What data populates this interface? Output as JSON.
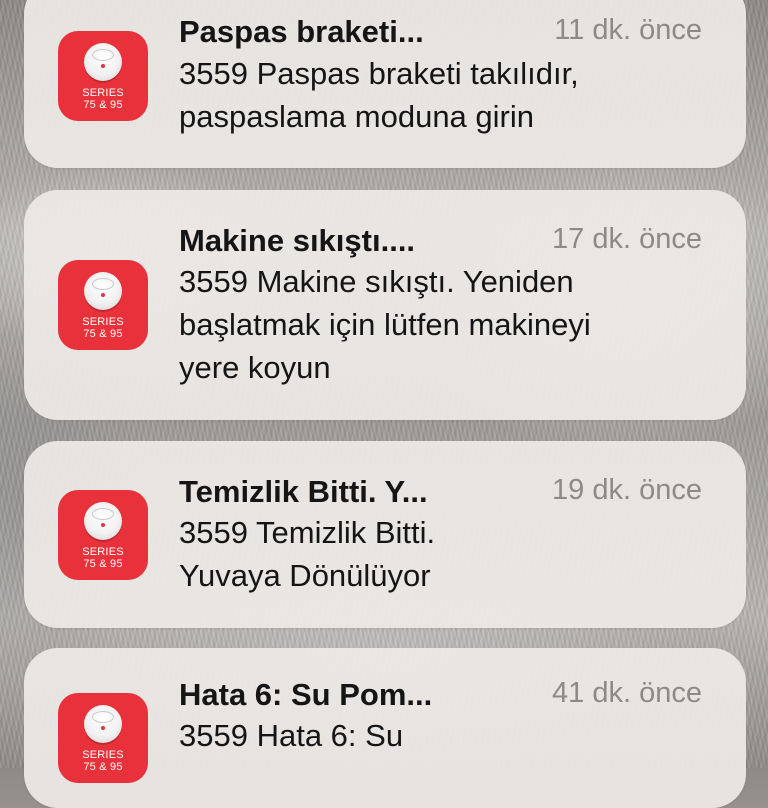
{
  "app": {
    "icon_name": "robot-vacuum-app-icon",
    "icon_color": "#e8313a",
    "icon_text_line1": "SERIES",
    "icon_text_line2": "75 & 95"
  },
  "notifications": [
    {
      "title": "Paspas braketi...",
      "time": "11 dk. önce",
      "body_line1": "3559  Paspas braketi takılıdır,",
      "body_line2": "paspaslama moduna girin",
      "body_line3": ""
    },
    {
      "title": "Makine sıkıştı....",
      "time": "17 dk. önce",
      "body_line1": "3559 Makine sıkıştı. Yeniden",
      "body_line2": "başlatmak için lütfen makineyi",
      "body_line3": "yere koyun"
    },
    {
      "title": "Temizlik Bitti. Y...",
      "time": "19 dk. önce",
      "body_line1": "3559 Temizlik Bitti.",
      "body_line2": "Yuvaya Dönülüyor",
      "body_line3": ""
    },
    {
      "title": "Hata 6: Su Pom...",
      "time": "41 dk. önce",
      "body_line1": "3559 Hata 6: Su",
      "body_line2": "",
      "body_line3": ""
    }
  ]
}
